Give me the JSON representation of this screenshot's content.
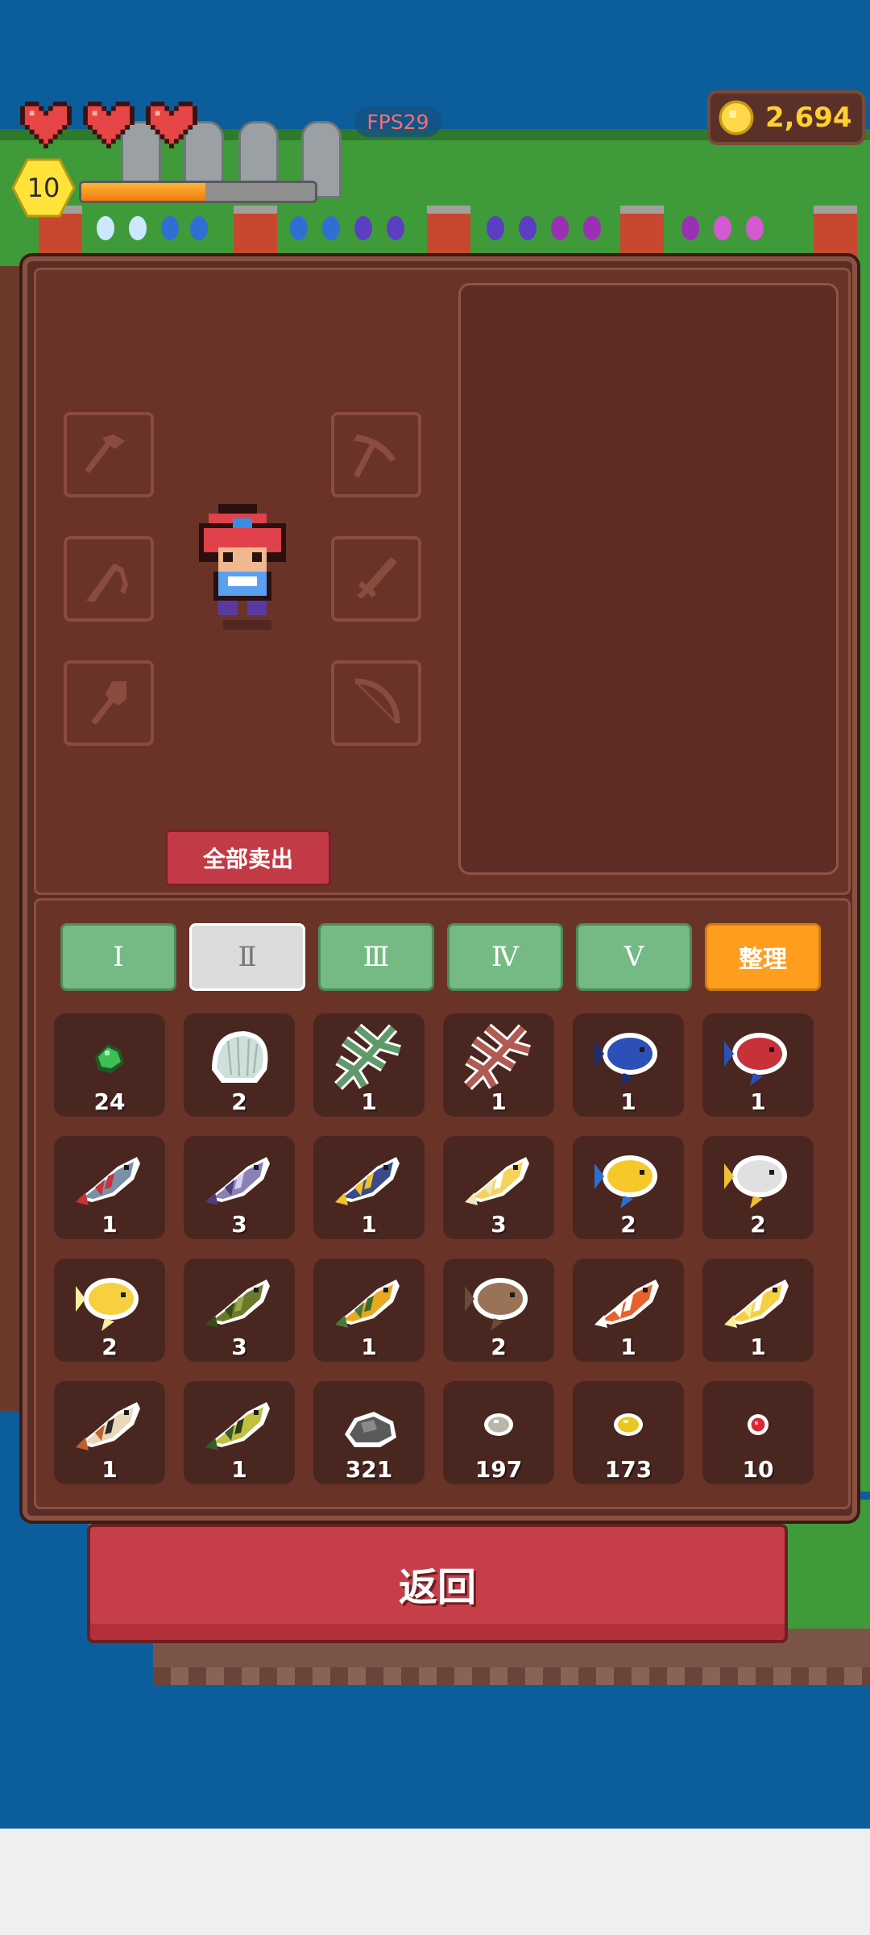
{
  "hud": {
    "hearts": [
      "heart-icon",
      "heart-icon",
      "heart-icon"
    ],
    "level": "10",
    "xp_fraction": 0.53,
    "fps": "FPS29",
    "coins": "2,694"
  },
  "equipment": {
    "slots_left": [
      "axe-icon",
      "fishing-rod-icon",
      "shovel-icon"
    ],
    "slots_right": [
      "pickaxe-icon",
      "sword-icon",
      "bow-icon"
    ],
    "sell_all_label": "全部卖出"
  },
  "tabs": [
    {
      "label": "Ⅰ",
      "active": false
    },
    {
      "label": "Ⅱ",
      "active": true
    },
    {
      "label": "Ⅲ",
      "active": false
    },
    {
      "label": "Ⅳ",
      "active": false
    },
    {
      "label": "Ⅴ",
      "active": false
    }
  ],
  "sort_label": "整理",
  "items": [
    {
      "icon": "green-gem-icon",
      "count": "24"
    },
    {
      "icon": "shell-icon",
      "count": "2"
    },
    {
      "icon": "green-seaweed-icon",
      "count": "1"
    },
    {
      "icon": "red-seaweed-icon",
      "count": "1"
    },
    {
      "icon": "blue-fish-icon",
      "count": "1"
    },
    {
      "icon": "red-fish-icon",
      "count": "1"
    },
    {
      "icon": "swordfish-icon",
      "count": "1"
    },
    {
      "icon": "purple-fish-icon",
      "count": "3"
    },
    {
      "icon": "yellow-dart-fish-icon",
      "count": "1"
    },
    {
      "icon": "golden-fish-icon",
      "count": "3"
    },
    {
      "icon": "yellow-blue-fish-icon",
      "count": "2"
    },
    {
      "icon": "white-fish-icon",
      "count": "2"
    },
    {
      "icon": "yellow-puffer-fish-icon",
      "count": "2"
    },
    {
      "icon": "olive-fish-icon",
      "count": "3"
    },
    {
      "icon": "green-yellow-fish-icon",
      "count": "1"
    },
    {
      "icon": "brown-fish-icon",
      "count": "2"
    },
    {
      "icon": "clownfish-icon",
      "count": "1"
    },
    {
      "icon": "yellow-fish-icon",
      "count": "1"
    },
    {
      "icon": "striped-fish-icon",
      "count": "1"
    },
    {
      "icon": "green-striped-fish-icon",
      "count": "1"
    },
    {
      "icon": "stone-ore-icon",
      "count": "321"
    },
    {
      "icon": "silver-nugget-icon",
      "count": "197"
    },
    {
      "icon": "gold-nugget-icon",
      "count": "173"
    },
    {
      "icon": "ruby-icon",
      "count": "10"
    }
  ],
  "back_label": "返回",
  "colors": {
    "accent": "#c63f48",
    "sort": "#ff9d1e",
    "tab": "#75b985"
  }
}
